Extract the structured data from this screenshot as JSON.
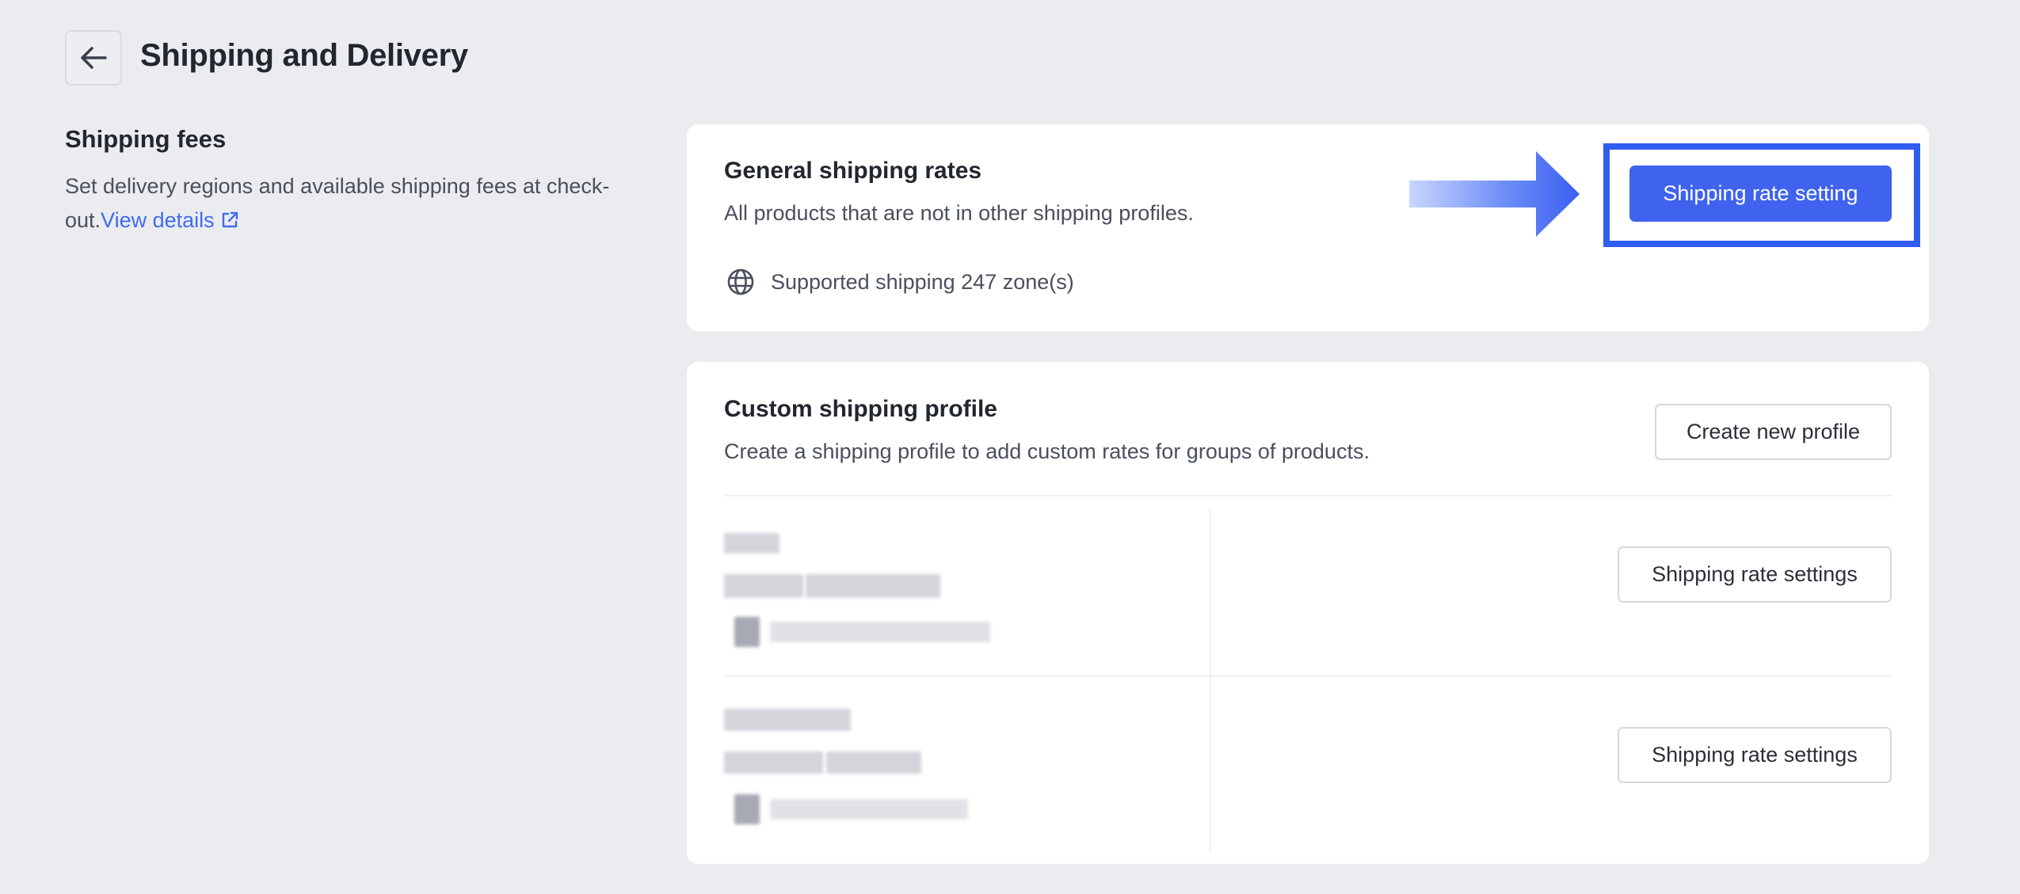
{
  "header": {
    "back_icon": "arrow-left-icon",
    "title": "Shipping and Delivery"
  },
  "left_panel": {
    "title": "Shipping fees",
    "description": "Set delivery regions and available shipping fees at check-out.",
    "link_label": "View details",
    "link_icon": "external-link-icon"
  },
  "general_rates": {
    "title": "General shipping rates",
    "description": "All products that are not in other shipping profiles.",
    "zone_icon": "globe-icon",
    "zone_text": "Supported shipping 247 zone(s)",
    "button_label": "Shipping rate setting"
  },
  "custom_profile": {
    "title": "Custom shipping profile",
    "description": "Create a shipping profile to add custom rates for groups of products.",
    "create_button_label": "Create new profile",
    "profiles": [
      {
        "button_label": "Shipping rate settings"
      },
      {
        "button_label": "Shipping rate settings"
      }
    ]
  },
  "colors": {
    "accent": "#3f63ee",
    "highlight": "#2f5df0",
    "link": "#3f6bf0",
    "background": "#ebecf0"
  }
}
